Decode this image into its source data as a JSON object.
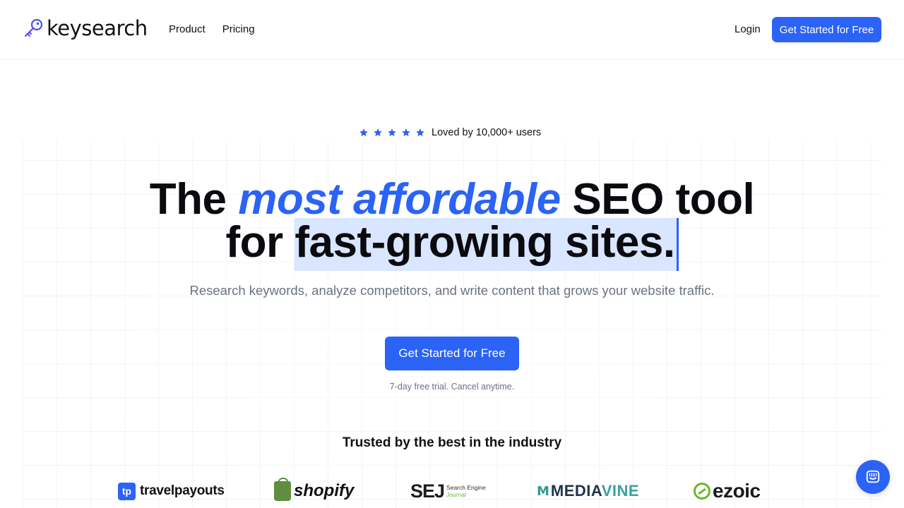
{
  "header": {
    "logo_text": "keysearch",
    "nav": [
      "Product",
      "Pricing"
    ],
    "login_label": "Login",
    "cta_label": "Get Started for Free"
  },
  "hero": {
    "rating_text": "Loved by 10,000+ users",
    "stars": 5,
    "headline_part1": "The ",
    "headline_accent": "most affordable",
    "headline_part2": " SEO tool",
    "headline_line2_prefix": "for ",
    "headline_line2_selected": "fast-growing sites.",
    "subtitle": "Research keywords, analyze competitors, and write content that grows your website traffic.",
    "cta_label": "Get Started for Free",
    "trial_note": "7-day free trial. Cancel anytime."
  },
  "trusted": {
    "title": "Trusted by the best in the industry",
    "brands": {
      "travelpayouts": "travelpayouts",
      "travelpayouts_mark": "tp",
      "shopify": "shopify",
      "sej_big": "SEJ",
      "sej_small_1": "Search Engine",
      "sej_small_2": "Journal",
      "mediavine_mark": "Ⅿ",
      "mediavine_1": "MEDIA",
      "mediavine_2": "VINE",
      "ezoic": "ezoic"
    }
  },
  "colors": {
    "accent": "#2b63f6",
    "muted_text": "#6b7280",
    "selection": "#d9e6ff"
  },
  "icons": [
    "key-icon",
    "star-icon",
    "chat-icon"
  ]
}
